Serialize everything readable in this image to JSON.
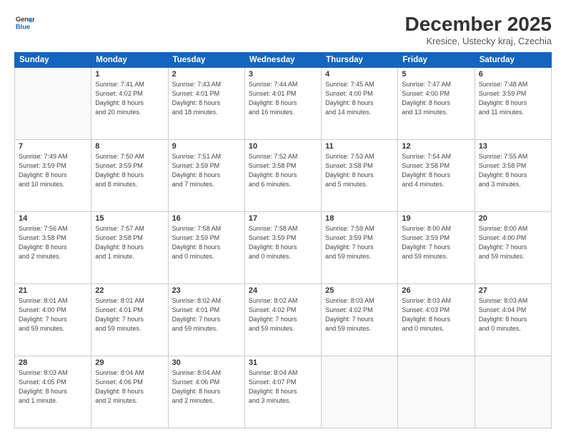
{
  "logo": {
    "line1": "General",
    "line2": "Blue"
  },
  "title": "December 2025",
  "subtitle": "Kresice, Ustecky kraj, Czechia",
  "header_days": [
    "Sunday",
    "Monday",
    "Tuesday",
    "Wednesday",
    "Thursday",
    "Friday",
    "Saturday"
  ],
  "weeks": [
    [
      {
        "num": "",
        "info": ""
      },
      {
        "num": "1",
        "info": "Sunrise: 7:41 AM\nSunset: 4:02 PM\nDaylight: 8 hours\nand 20 minutes."
      },
      {
        "num": "2",
        "info": "Sunrise: 7:43 AM\nSunset: 4:01 PM\nDaylight: 8 hours\nand 18 minutes."
      },
      {
        "num": "3",
        "info": "Sunrise: 7:44 AM\nSunset: 4:01 PM\nDaylight: 8 hours\nand 16 minutes."
      },
      {
        "num": "4",
        "info": "Sunrise: 7:45 AM\nSunset: 4:00 PM\nDaylight: 8 hours\nand 14 minutes."
      },
      {
        "num": "5",
        "info": "Sunrise: 7:47 AM\nSunset: 4:00 PM\nDaylight: 8 hours\nand 13 minutes."
      },
      {
        "num": "6",
        "info": "Sunrise: 7:48 AM\nSunset: 3:59 PM\nDaylight: 8 hours\nand 11 minutes."
      }
    ],
    [
      {
        "num": "7",
        "info": "Sunrise: 7:49 AM\nSunset: 3:59 PM\nDaylight: 8 hours\nand 10 minutes."
      },
      {
        "num": "8",
        "info": "Sunrise: 7:50 AM\nSunset: 3:59 PM\nDaylight: 8 hours\nand 8 minutes."
      },
      {
        "num": "9",
        "info": "Sunrise: 7:51 AM\nSunset: 3:59 PM\nDaylight: 8 hours\nand 7 minutes."
      },
      {
        "num": "10",
        "info": "Sunrise: 7:52 AM\nSunset: 3:58 PM\nDaylight: 8 hours\nand 6 minutes."
      },
      {
        "num": "11",
        "info": "Sunrise: 7:53 AM\nSunset: 3:58 PM\nDaylight: 8 hours\nand 5 minutes."
      },
      {
        "num": "12",
        "info": "Sunrise: 7:54 AM\nSunset: 3:58 PM\nDaylight: 8 hours\nand 4 minutes."
      },
      {
        "num": "13",
        "info": "Sunrise: 7:55 AM\nSunset: 3:58 PM\nDaylight: 8 hours\nand 3 minutes."
      }
    ],
    [
      {
        "num": "14",
        "info": "Sunrise: 7:56 AM\nSunset: 3:58 PM\nDaylight: 8 hours\nand 2 minutes."
      },
      {
        "num": "15",
        "info": "Sunrise: 7:57 AM\nSunset: 3:58 PM\nDaylight: 8 hours\nand 1 minute."
      },
      {
        "num": "16",
        "info": "Sunrise: 7:58 AM\nSunset: 3:59 PM\nDaylight: 8 hours\nand 0 minutes."
      },
      {
        "num": "17",
        "info": "Sunrise: 7:58 AM\nSunset: 3:59 PM\nDaylight: 8 hours\nand 0 minutes."
      },
      {
        "num": "18",
        "info": "Sunrise: 7:59 AM\nSunset: 3:59 PM\nDaylight: 7 hours\nand 59 minutes."
      },
      {
        "num": "19",
        "info": "Sunrise: 8:00 AM\nSunset: 3:59 PM\nDaylight: 7 hours\nand 59 minutes."
      },
      {
        "num": "20",
        "info": "Sunrise: 8:00 AM\nSunset: 4:00 PM\nDaylight: 7 hours\nand 59 minutes."
      }
    ],
    [
      {
        "num": "21",
        "info": "Sunrise: 8:01 AM\nSunset: 4:00 PM\nDaylight: 7 hours\nand 59 minutes."
      },
      {
        "num": "22",
        "info": "Sunrise: 8:01 AM\nSunset: 4:01 PM\nDaylight: 7 hours\nand 59 minutes."
      },
      {
        "num": "23",
        "info": "Sunrise: 8:02 AM\nSunset: 4:01 PM\nDaylight: 7 hours\nand 59 minutes."
      },
      {
        "num": "24",
        "info": "Sunrise: 8:02 AM\nSunset: 4:02 PM\nDaylight: 7 hours\nand 59 minutes."
      },
      {
        "num": "25",
        "info": "Sunrise: 8:03 AM\nSunset: 4:02 PM\nDaylight: 7 hours\nand 59 minutes."
      },
      {
        "num": "26",
        "info": "Sunrise: 8:03 AM\nSunset: 4:03 PM\nDaylight: 8 hours\nand 0 minutes."
      },
      {
        "num": "27",
        "info": "Sunrise: 8:03 AM\nSunset: 4:04 PM\nDaylight: 8 hours\nand 0 minutes."
      }
    ],
    [
      {
        "num": "28",
        "info": "Sunrise: 8:03 AM\nSunset: 4:05 PM\nDaylight: 8 hours\nand 1 minute."
      },
      {
        "num": "29",
        "info": "Sunrise: 8:04 AM\nSunset: 4:06 PM\nDaylight: 8 hours\nand 2 minutes."
      },
      {
        "num": "30",
        "info": "Sunrise: 8:04 AM\nSunset: 4:06 PM\nDaylight: 8 hours\nand 2 minutes."
      },
      {
        "num": "31",
        "info": "Sunrise: 8:04 AM\nSunset: 4:07 PM\nDaylight: 8 hours\nand 3 minutes."
      },
      {
        "num": "",
        "info": ""
      },
      {
        "num": "",
        "info": ""
      },
      {
        "num": "",
        "info": ""
      }
    ]
  ]
}
